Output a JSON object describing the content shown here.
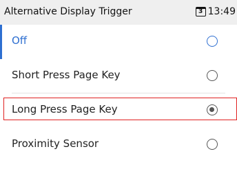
{
  "header": {
    "title": "Alternative Display Trigger",
    "calendar_day": "3",
    "time": "13:49"
  },
  "options": [
    {
      "label": "Off",
      "selected_row": true,
      "checked": false
    },
    {
      "label": "Short Press Page Key",
      "selected_row": false,
      "checked": false
    },
    {
      "label": "Long Press Page Key",
      "selected_row": false,
      "checked": true
    },
    {
      "label": "Proximity Sensor",
      "selected_row": false,
      "checked": false
    }
  ],
  "colors": {
    "accent": "#2e6fd1",
    "highlight_box": "#e02020",
    "statusbar_bg": "#efefef"
  }
}
